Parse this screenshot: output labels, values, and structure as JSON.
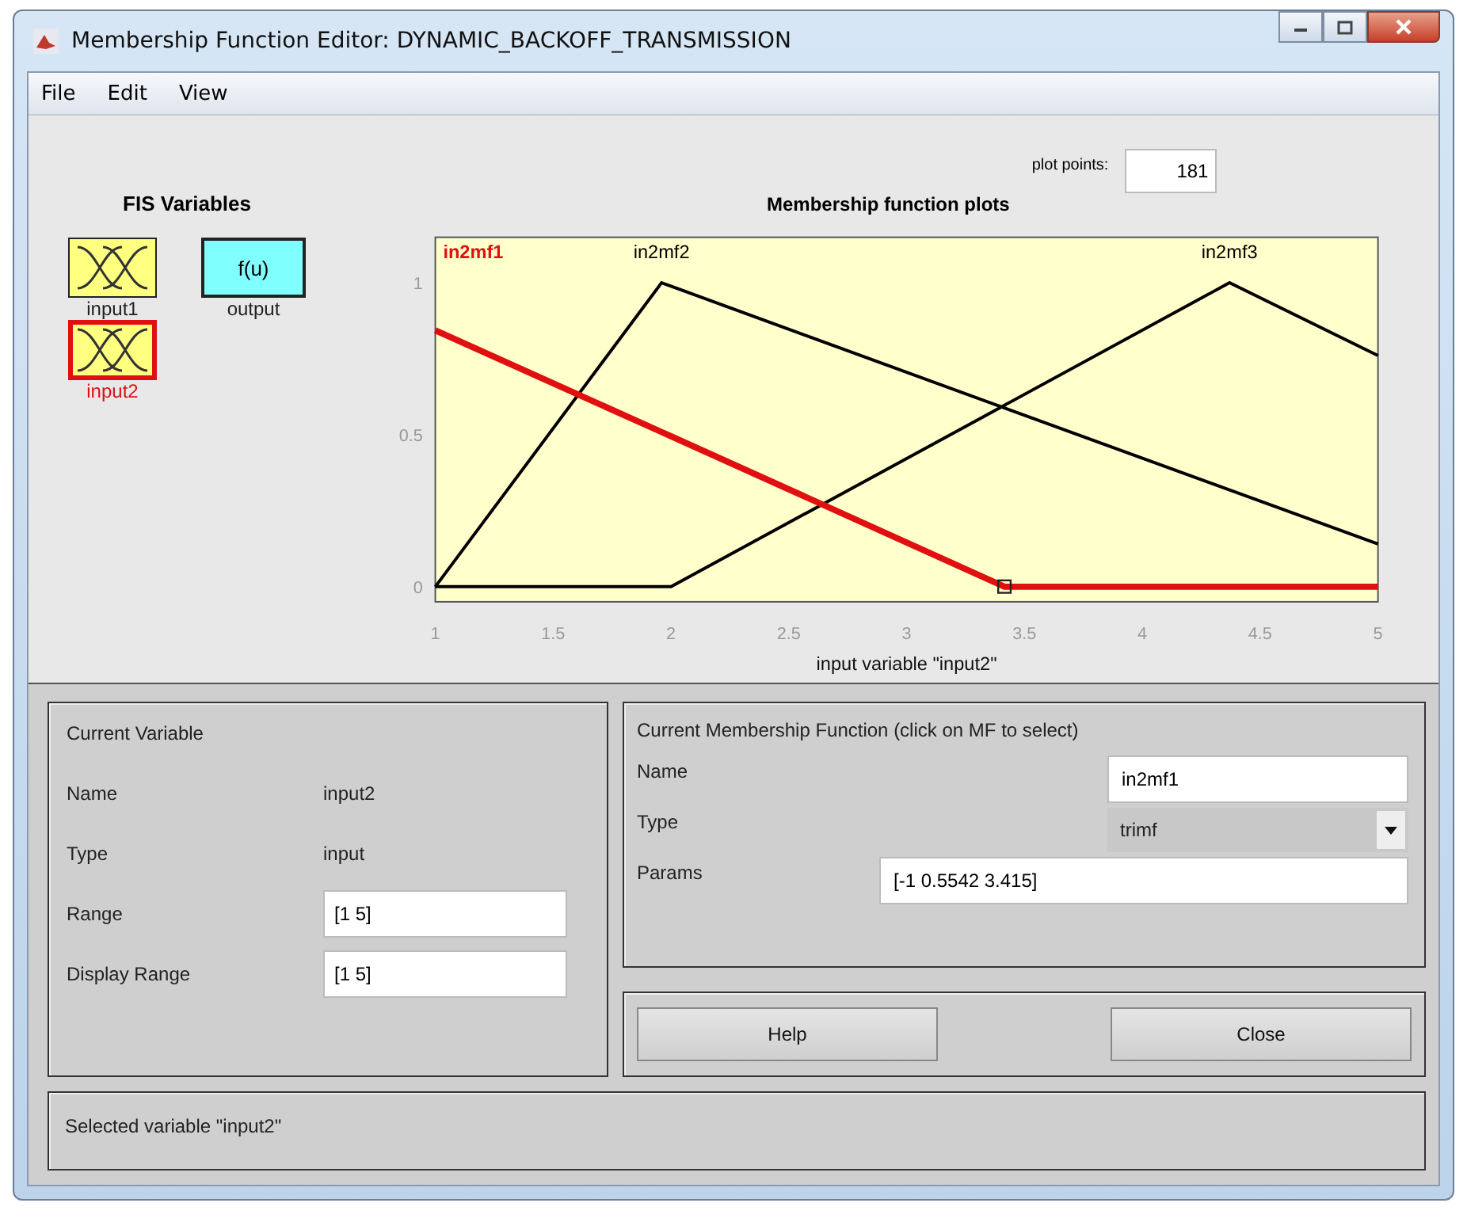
{
  "window": {
    "title": "Membership Function Editor: DYNAMIC_BACKOFF_TRANSMISSION"
  },
  "menu": [
    "File",
    "Edit",
    "View"
  ],
  "fis_variables": {
    "title": "FIS Variables",
    "items": [
      {
        "label": "input1",
        "kind": "input",
        "selected": false
      },
      {
        "label": "output",
        "kind": "output",
        "icon_text": "f(u)",
        "selected": false
      },
      {
        "label": "input2",
        "kind": "input",
        "selected": true
      }
    ]
  },
  "plot": {
    "title": "Membership function plots",
    "plot_points_label": "plot points:",
    "plot_points": "181",
    "chart_data": {
      "type": "line",
      "xlabel": "input variable \"input2\"",
      "x": [
        1,
        1.96,
        2,
        3.415,
        4.37,
        5
      ],
      "xlim": [
        1,
        5
      ],
      "ylim": [
        -0.05,
        1.15
      ],
      "xticks": [
        1,
        1.5,
        2,
        2.5,
        3,
        3.5,
        4,
        4.5,
        5
      ],
      "yticks": [
        0,
        0.5,
        1
      ],
      "series": [
        {
          "name": "in2mf1",
          "color": "#e01010",
          "values": [
            0.844,
            0.509,
            0.495,
            0,
            0,
            0
          ]
        },
        {
          "name": "in2mf2",
          "color": "#000000",
          "values": [
            0,
            1,
            0.989,
            0.588,
            0.318,
            0.14
          ]
        },
        {
          "name": "in2mf3",
          "color": "#000000",
          "values": [
            0,
            0,
            0,
            0.597,
            1,
            0.76
          ]
        }
      ]
    },
    "curve_states": [
      {
        "selected": true
      },
      {
        "selected": false
      },
      {
        "selected": false
      }
    ]
  },
  "current_variable": {
    "title": "Current Variable",
    "rows": [
      {
        "label": "Name",
        "value": "input2",
        "kind": "text"
      },
      {
        "label": "Type",
        "value": "input",
        "kind": "text"
      },
      {
        "label": "Range",
        "value": "[1 5]",
        "kind": "field"
      },
      {
        "label": "Display Range",
        "value": "[1 5]",
        "kind": "field"
      }
    ]
  },
  "current_mf": {
    "title": "Current Membership Function (click on MF to select)",
    "rows": [
      {
        "label": "Name",
        "value": "in2mf1",
        "kind": "field"
      },
      {
        "label": "Type",
        "value": "trimf",
        "kind": "dropdown"
      },
      {
        "label": "Params",
        "value": "[-1 0.5542 3.415]",
        "kind": "wide_field"
      }
    ]
  },
  "buttons": [
    "Help",
    "Close"
  ],
  "status_bar": "Selected variable \"input2\""
}
